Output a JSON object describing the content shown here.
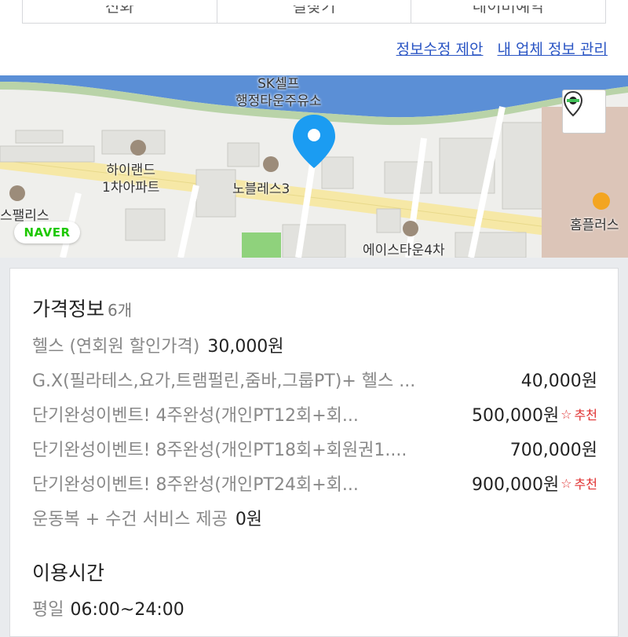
{
  "top_tabs": [
    {
      "label": "전화"
    },
    {
      "label": "길찾기"
    },
    {
      "label": "네이버예약"
    }
  ],
  "edit_links": {
    "suggest": "정보수정 제안",
    "manage": "내 업체 정보 관리"
  },
  "map": {
    "labels": {
      "gas_station": "SK셀프\n행정타운주유소",
      "highland": "하이랜드\n1차아파트",
      "noblesse": "노블레스3",
      "spalace": "스팰리스",
      "homeplus": "홈플러스",
      "acetown": "에이스타운4차"
    },
    "naver_badge": "NAVER"
  },
  "price_section": {
    "title": "가격정보",
    "count": "6개",
    "items": [
      {
        "name": "헬스 (연회원 할인가격)",
        "price": "30,000원"
      },
      {
        "name": "G.X(필라테스,요가,트램펄린,줌바,그룹PT)+ 헬스 ...",
        "price": "40,000원"
      },
      {
        "name": "단기완성이벤트! 4주완성(개인PT12회+회...",
        "price": "500,000원",
        "recommend": "추천"
      },
      {
        "name": "단기완성이벤트! 8주완성(개인PT18회+회원권1....",
        "price": "700,000원"
      },
      {
        "name": "단기완성이벤트! 8주완성(개인PT24회+회...",
        "price": "900,000원",
        "recommend": "추천"
      },
      {
        "name": "운동복 + 수건 서비스 제공",
        "price": "0원"
      }
    ]
  },
  "hours_section": {
    "title": "이용시간",
    "weekday_label": "평일",
    "weekday_value": "06:00~24:00"
  },
  "colors": {
    "link": "#2a55c4",
    "recommend": "#e03131",
    "pin": "#1b9cf2",
    "river": "#5b8fd6",
    "naver_green": "#1ec800"
  }
}
